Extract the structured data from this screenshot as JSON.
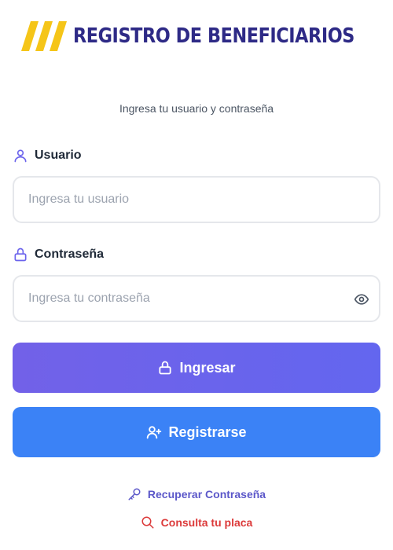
{
  "brand": {
    "name": "REGISTRO DE BENEFICIARIOS",
    "logo_color": "#f5c518",
    "text_color": "#2e2a86"
  },
  "subtitle": "Ingresa tu usuario y contraseña",
  "user_field": {
    "label": "Usuario",
    "placeholder": "Ingresa tu usuario",
    "value": "",
    "icon": "user-icon"
  },
  "password_field": {
    "label": "Contraseña",
    "placeholder": "Ingresa tu contraseña",
    "value": "",
    "icon": "lock-icon",
    "toggle_icon": "eye-icon"
  },
  "buttons": {
    "login": {
      "label": "Ingresar",
      "icon": "lock-icon",
      "color": "#6b63ec"
    },
    "register": {
      "label": "Registrarse",
      "icon": "user-plus-icon",
      "color": "#3b82f6"
    }
  },
  "links": {
    "recover": {
      "label": "Recuperar Contraseña",
      "icon": "key-icon",
      "color": "#5b57c9"
    },
    "plate": {
      "label": "Consulta tu placa",
      "icon": "search-icon",
      "color": "#dc3a3a"
    }
  }
}
